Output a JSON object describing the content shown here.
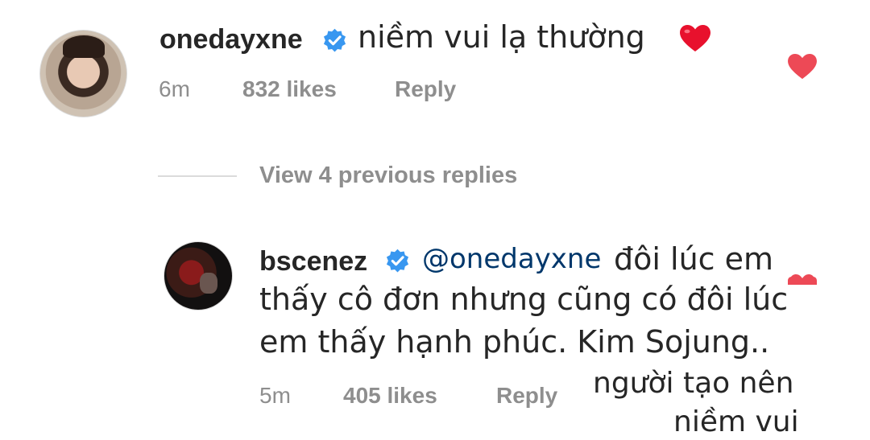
{
  "comment": {
    "username": "onedayxne",
    "text": "niềm vui lạ thường",
    "emoji": "❤️",
    "time": "6m",
    "likes": "832 likes",
    "reply_label": "Reply"
  },
  "view_replies": "View 4 previous replies",
  "reply": {
    "username": "bscenez",
    "mention": "@onedayxne",
    "line1_text": "đôi lúc em",
    "line2": "thấy cô đơn nhưng cũng có đôi lúc",
    "line3": "em thấy hạnh phúc. Kim Sojung..",
    "time": "5m",
    "likes": "405 likes",
    "reply_label": "Reply"
  },
  "overlay_caption": {
    "line1": "người tạo nên",
    "line2": "niềm vui"
  },
  "colors": {
    "text": "#262626",
    "meta": "#8e8e8e",
    "verified": "#3897f0",
    "heart": "#ed4956",
    "mention": "#00376b"
  }
}
